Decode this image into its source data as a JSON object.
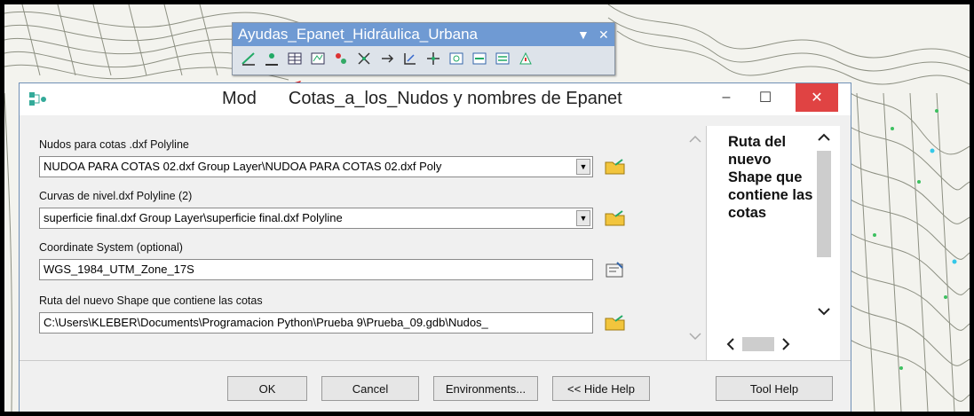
{
  "toolbar": {
    "title": "Ayudas_Epanet_Hidráulica_Urbana",
    "dropdown_glyph": "▼",
    "close_glyph": "✕",
    "icons": [
      "tool-1-icon",
      "tool-2-icon",
      "table-icon",
      "map-icon",
      "tool-5-icon",
      "tool-6-icon",
      "tool-7-icon",
      "tool-8-icon",
      "tool-9-icon",
      "tool-10-icon",
      "tool-11-icon",
      "tool-12-icon",
      "tool-13-icon"
    ]
  },
  "dialog": {
    "title": "Mod    Cotas_a_los_Nudos y nombres de Epanet",
    "title_left": "Mod",
    "title_right": "Cotas_a_los_Nudos y nombres de Epanet",
    "minimize_glyph": "–",
    "maximize_glyph": "☐",
    "close_glyph": "✕",
    "fields": {
      "nodes_label": "Nudos para cotas .dxf Polyline",
      "nodes_value": "NUDOA PARA COTAS 02.dxf Group Layer\\NUDOA PARA COTAS 02.dxf Poly",
      "contours_label": "Curvas de nivel.dxf Polyline (2)",
      "contours_value": "superficie final.dxf Group Layer\\superficie final.dxf Polyline",
      "coord_label": "Coordinate System (optional)",
      "coord_value": "WGS_1984_UTM_Zone_17S",
      "output_label": "Ruta del nuevo Shape que contiene las cotas",
      "output_value": "C:\\Users\\KLEBER\\Documents\\Programacion Python\\Prueba 9\\Prueba_09.gdb\\Nudos_"
    },
    "help_text": "Ruta del nuevo Shape que contiene las cotas",
    "buttons": {
      "ok": "OK",
      "cancel": "Cancel",
      "environments": "Environments...",
      "hide_help": "<< Hide Help",
      "tool_help": "Tool Help"
    }
  },
  "colors": {
    "toolbar_title_bg": "#6f9ad3",
    "close_red": "#e04343",
    "folder_yellow": "#f2c53d",
    "arrow_red": "#e02020",
    "arrow_blue": "#1f4fa0"
  }
}
